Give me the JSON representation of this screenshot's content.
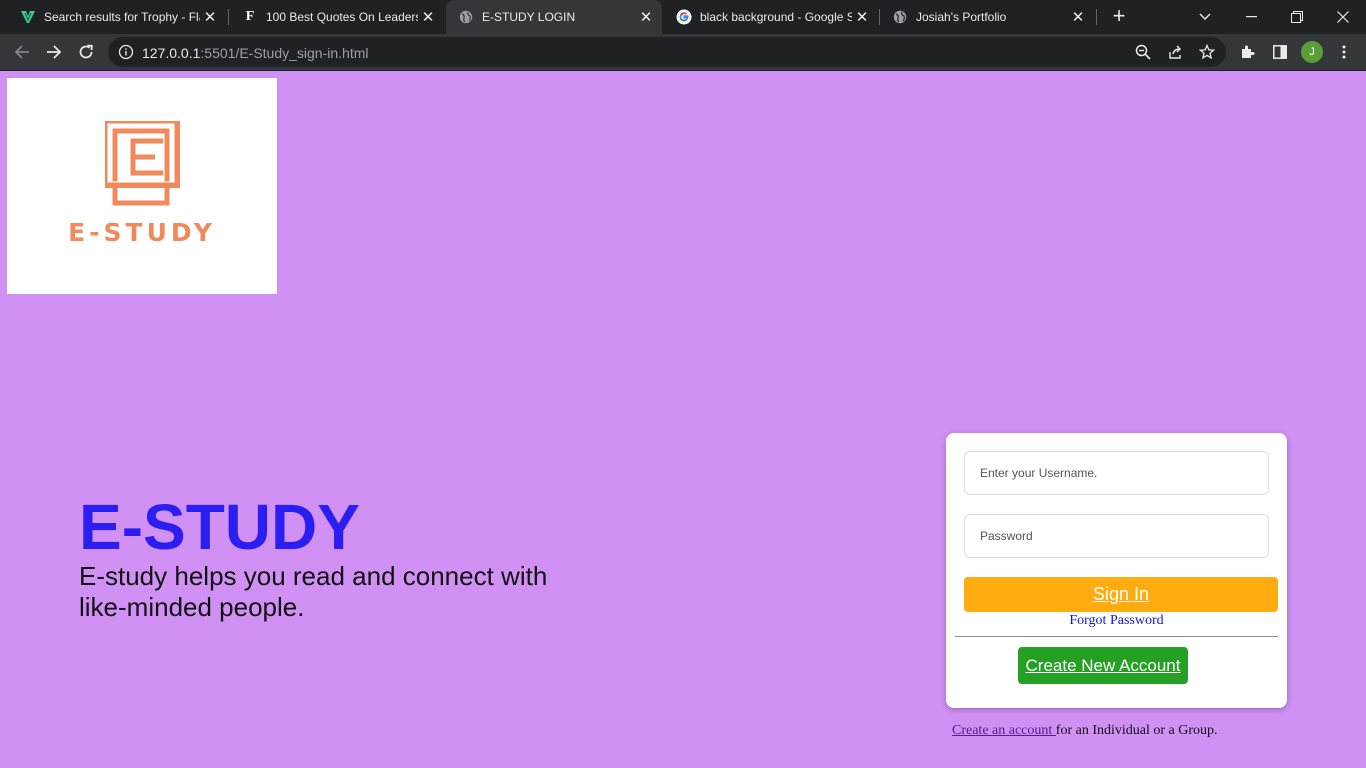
{
  "browser": {
    "tabs": [
      {
        "title": "Search results for Trophy - Fla",
        "favicon": "vector-logo-icon"
      },
      {
        "title": "100 Best Quotes On Leadershi",
        "favicon": "f-letter-icon"
      },
      {
        "title": "E-STUDY LOGIN",
        "favicon": "globe-icon",
        "active": true
      },
      {
        "title": "black background - Google Se",
        "favicon": "google-icon"
      },
      {
        "title": "Josiah's Portfolio",
        "favicon": "globe-icon"
      }
    ],
    "url_host": "127.0.0.1",
    "url_rest": ":5501/E-Study_sign-in.html",
    "profile_initial": "J"
  },
  "logo": {
    "text": "E-STUDY",
    "color": "#f08a5d"
  },
  "hero": {
    "title": "E-STUDY",
    "description": "E-study helps you read and connect with like-minded people."
  },
  "login": {
    "username_placeholder": "Enter your Username.",
    "password_placeholder": "Password",
    "signin_label": "Sign In",
    "forgot_label": "Forgot Password",
    "create_label": "Create New Account"
  },
  "footer": {
    "link_text": "Create an account ",
    "rest_text": "for an Individual or a Group."
  },
  "colors": {
    "page_background": "#d090f4",
    "title_blue": "#2a1ff0",
    "signin_orange": "#ffac11",
    "create_green": "#25a025"
  }
}
